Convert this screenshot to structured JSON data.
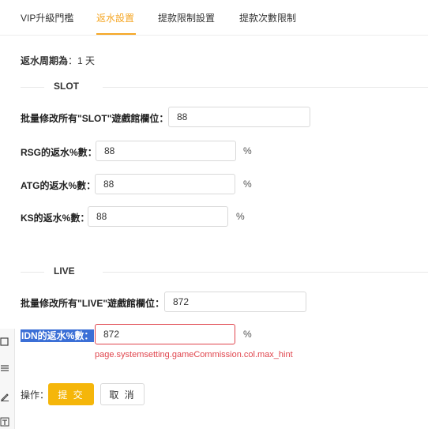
{
  "tabs": [
    {
      "label": "VIP升級門檻"
    },
    {
      "label": "返水設置"
    },
    {
      "label": "提款限制設置"
    },
    {
      "label": "提款次數限制"
    }
  ],
  "active_tab_color": "#f5a623",
  "period": {
    "label": "返水周期為",
    "value": "1 天"
  },
  "slot": {
    "section_title": "SLOT",
    "batch": {
      "label": "批量修改所有\"SLOT\"遊戲館欄位",
      "value": "88"
    },
    "rows": [
      {
        "label": "RSG的返水%數",
        "value": "88",
        "unit": "%"
      },
      {
        "label": "ATG的返水%數",
        "value": "88",
        "unit": "%"
      },
      {
        "label": "KS的返水%數",
        "value": "88",
        "unit": "%"
      }
    ]
  },
  "live": {
    "section_title": "LIVE",
    "batch": {
      "label": "批量修改所有\"LIVE\"遊戲館欄位",
      "value": "872"
    },
    "rows": [
      {
        "label": "IDN的返水%數",
        "value": "872",
        "unit": "%",
        "error": "page.systemsetting.gameCommission.col.max_hint"
      }
    ]
  },
  "actions": {
    "label": "操作",
    "submit": "提 交",
    "cancel": "取 消"
  },
  "colors": {
    "accent": "#f5a623",
    "submit_bg": "#f5b60a",
    "error": "#e0454d",
    "selection": "#3b6fd6"
  },
  "tools": [
    "square-icon",
    "list-icon",
    "pen-icon",
    "text-icon"
  ]
}
